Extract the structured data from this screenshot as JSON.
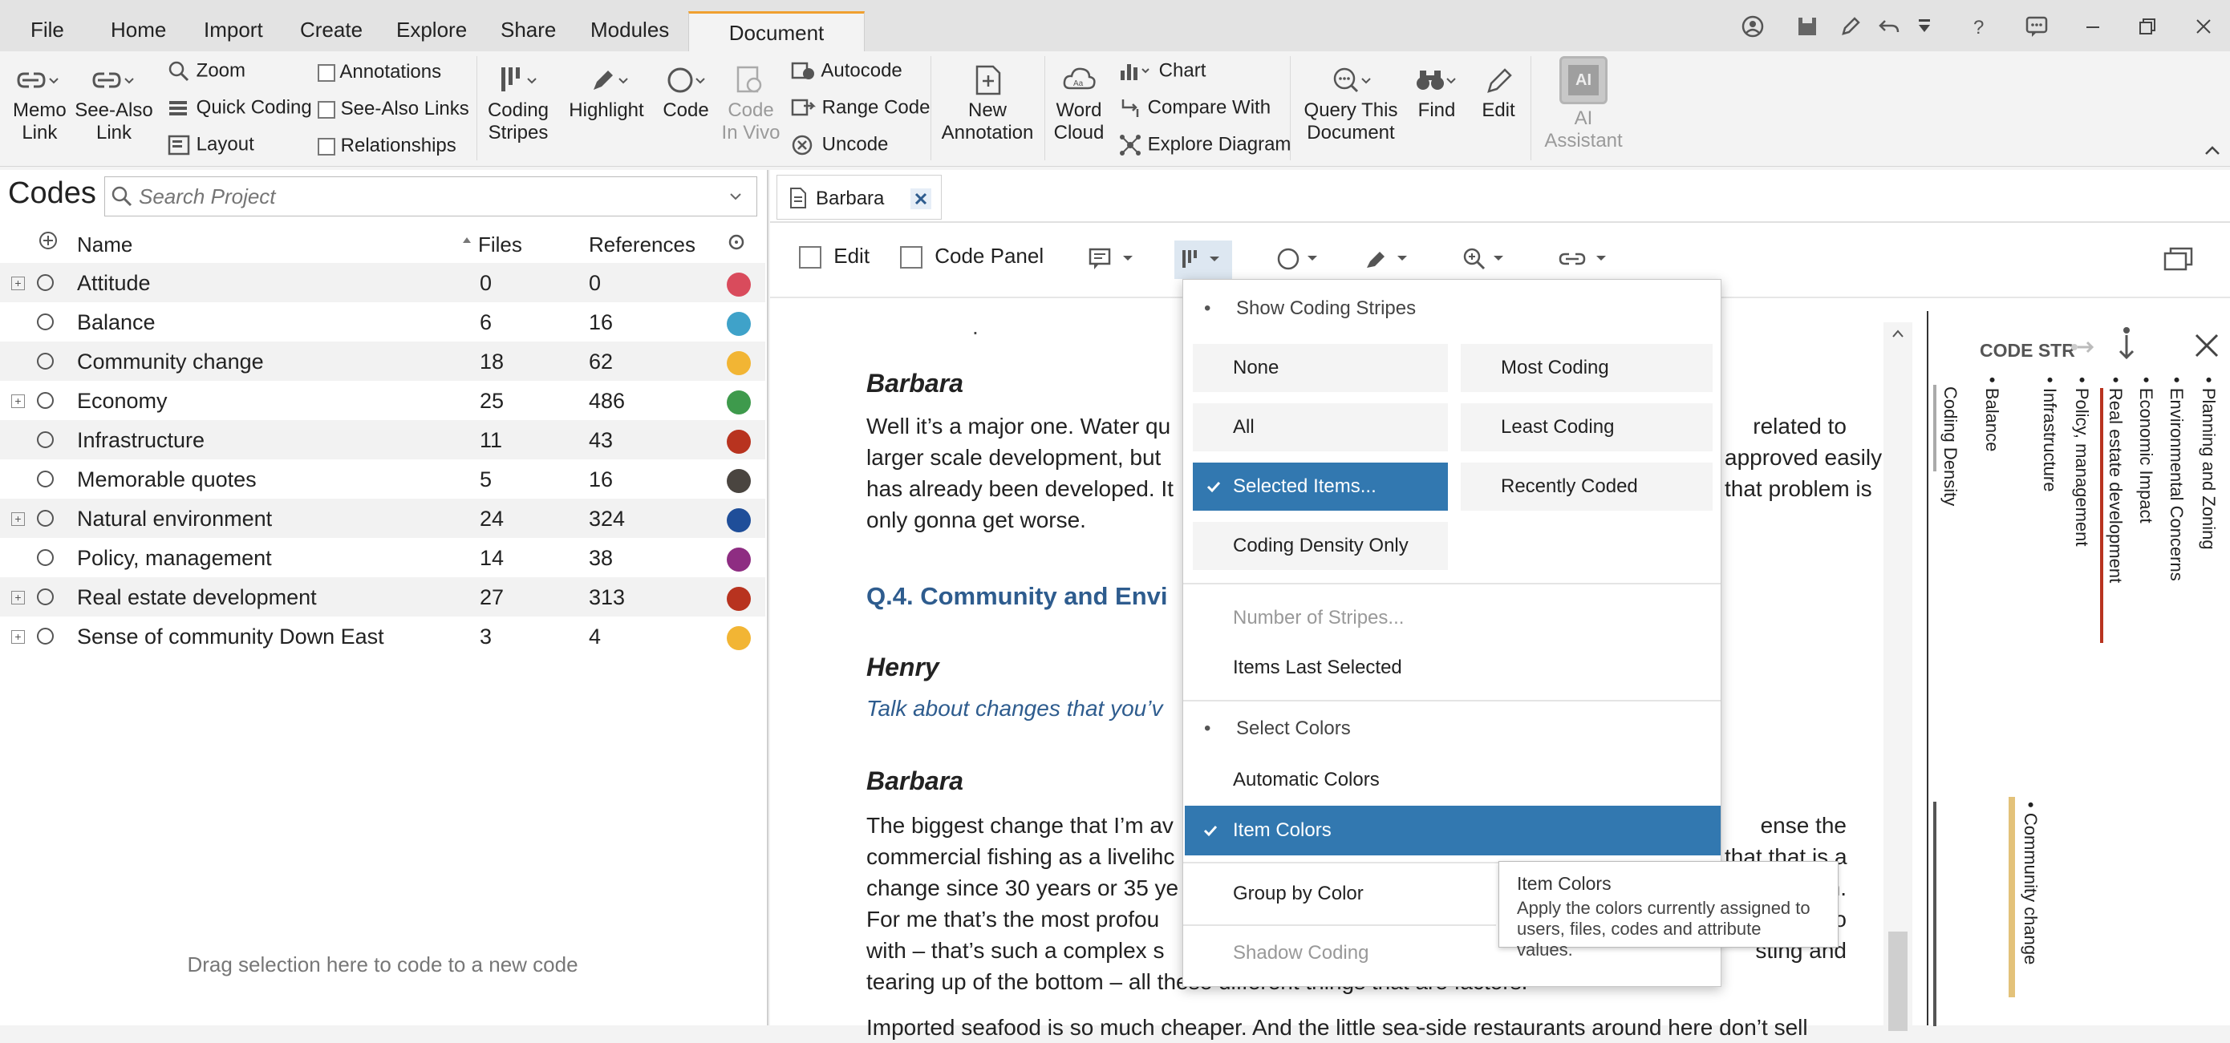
{
  "menu": {
    "file": "File",
    "home": "Home",
    "import": "Import",
    "create": "Create",
    "explore": "Explore",
    "share": "Share",
    "modules": "Modules",
    "document": "Document"
  },
  "ribbon": {
    "memo_link": "Memo\nLink",
    "memo_link_1": "Memo",
    "memo_link_2": "Link",
    "see_also_1": "See-Also",
    "see_also_2": "Link",
    "zoom": "Zoom",
    "quick_coding": "Quick Coding",
    "layout": "Layout",
    "annotations": "Annotations",
    "see_also_links": "See-Also Links",
    "relationships": "Relationships",
    "coding_1": "Coding",
    "coding_2": "Stripes",
    "highlight": "Highlight",
    "code": "Code",
    "code_in_vivo_1": "Code",
    "code_in_vivo_2": "In Vivo",
    "autocode": "Autocode",
    "range_code": "Range Code",
    "uncode": "Uncode",
    "new_1": "New",
    "new_2": "Annotation",
    "word_1": "Word",
    "word_2": "Cloud",
    "chart": "Chart",
    "compare_with": "Compare With",
    "explore_diagram": "Explore Diagram",
    "query_1": "Query This",
    "query_2": "Document",
    "find": "Find",
    "edit": "Edit",
    "ai_1": "AI",
    "ai_2": "Assistant",
    "ai_badge": "AI"
  },
  "codes_panel": {
    "title": "Codes",
    "search_placeholder": "Search Project",
    "col_name": "Name",
    "col_files": "Files",
    "col_refs": "References",
    "rows": [
      {
        "name": "Attitude",
        "files": "0",
        "refs": "0",
        "color": "#d94b5c",
        "expandable": true
      },
      {
        "name": "Balance",
        "files": "6",
        "refs": "16",
        "color": "#3fa2c9",
        "expandable": false
      },
      {
        "name": "Community change",
        "files": "18",
        "refs": "62",
        "color": "#f2b534",
        "expandable": false
      },
      {
        "name": "Economy",
        "files": "25",
        "refs": "486",
        "color": "#3e9a4c",
        "expandable": true
      },
      {
        "name": "Infrastructure",
        "files": "11",
        "refs": "43",
        "color": "#b8331f",
        "expandable": false
      },
      {
        "name": "Memorable quotes",
        "files": "5",
        "refs": "16",
        "color": "#4a4540",
        "expandable": false
      },
      {
        "name": "Natural environment",
        "files": "24",
        "refs": "324",
        "color": "#1f4e99",
        "expandable": true
      },
      {
        "name": "Policy, management",
        "files": "14",
        "refs": "38",
        "color": "#8e2d82",
        "expandable": false
      },
      {
        "name": "Real estate development",
        "files": "27",
        "refs": "313",
        "color": "#b8331f",
        "expandable": true
      },
      {
        "name": "Sense of community Down East",
        "files": "3",
        "refs": "4",
        "color": "#f2b534",
        "expandable": true
      }
    ],
    "drag_hint": "Drag selection here to code to a new code"
  },
  "document": {
    "tab_label": "Barbara",
    "edit_label": "Edit",
    "code_panel_label": "Code Panel",
    "dot": ".",
    "speaker1": "Barbara",
    "para1": [
      "Well it’s a major one. Water qu",
      "larger scale development, but",
      "has already been developed. It",
      "only gonna get worse."
    ],
    "para1_right": [
      "related to",
      "approved easily",
      "that problem is"
    ],
    "heading": "Q.4. Community and Envi",
    "speaker2": "Henry",
    "question": "Talk about changes that you’v",
    "speaker3": "Barbara",
    "para2": [
      "The biggest change that I’m av",
      "commercial fishing as a livelihc",
      "change since 30 years or 35 ye",
      "For me that’s the most profou",
      "with – that’s such a complex s",
      "tearing up of the bottom – all these different things that are factors."
    ],
    "para2_right": [
      "ense the",
      "that that is a",
      "m.",
      "do",
      "sting and"
    ],
    "para3": "Imported seafood is so much cheaper. And the little sea-side restaurants around here don’t sell"
  },
  "dropdown": {
    "show_coding_stripes": "Show Coding Stripes",
    "none": "None",
    "most_coding": "Most Coding",
    "all": "All",
    "least_coding": "Least Coding",
    "selected_items": "Selected Items...",
    "recently_coded": "Recently Coded",
    "coding_density_only": "Coding Density Only",
    "number_of_stripes": "Number of Stripes...",
    "items_last_selected": "Items Last Selected",
    "select_colors": "Select Colors",
    "automatic_colors": "Automatic Colors",
    "item_colors": "Item Colors",
    "group_by_color": "Group by Color",
    "shadow_coding": "Shadow Coding"
  },
  "tooltip": {
    "title": "Item Colors",
    "line1": "Apply the colors currently assigned to",
    "line2": "users, files, codes and attribute values."
  },
  "stripes_panel": {
    "title": "CODE STR",
    "labels": [
      "Coding Density",
      "Balance",
      "Infrastructure",
      "Policy, management",
      "Real estate development",
      "Economic Impact",
      "Environmental Concerns",
      "Planning and Zoning"
    ],
    "community_change": "Community change"
  },
  "colors": {
    "selected": "#3278b0",
    "accent_tab": "#f0a030",
    "heading_blue": "#2e5c8e"
  }
}
